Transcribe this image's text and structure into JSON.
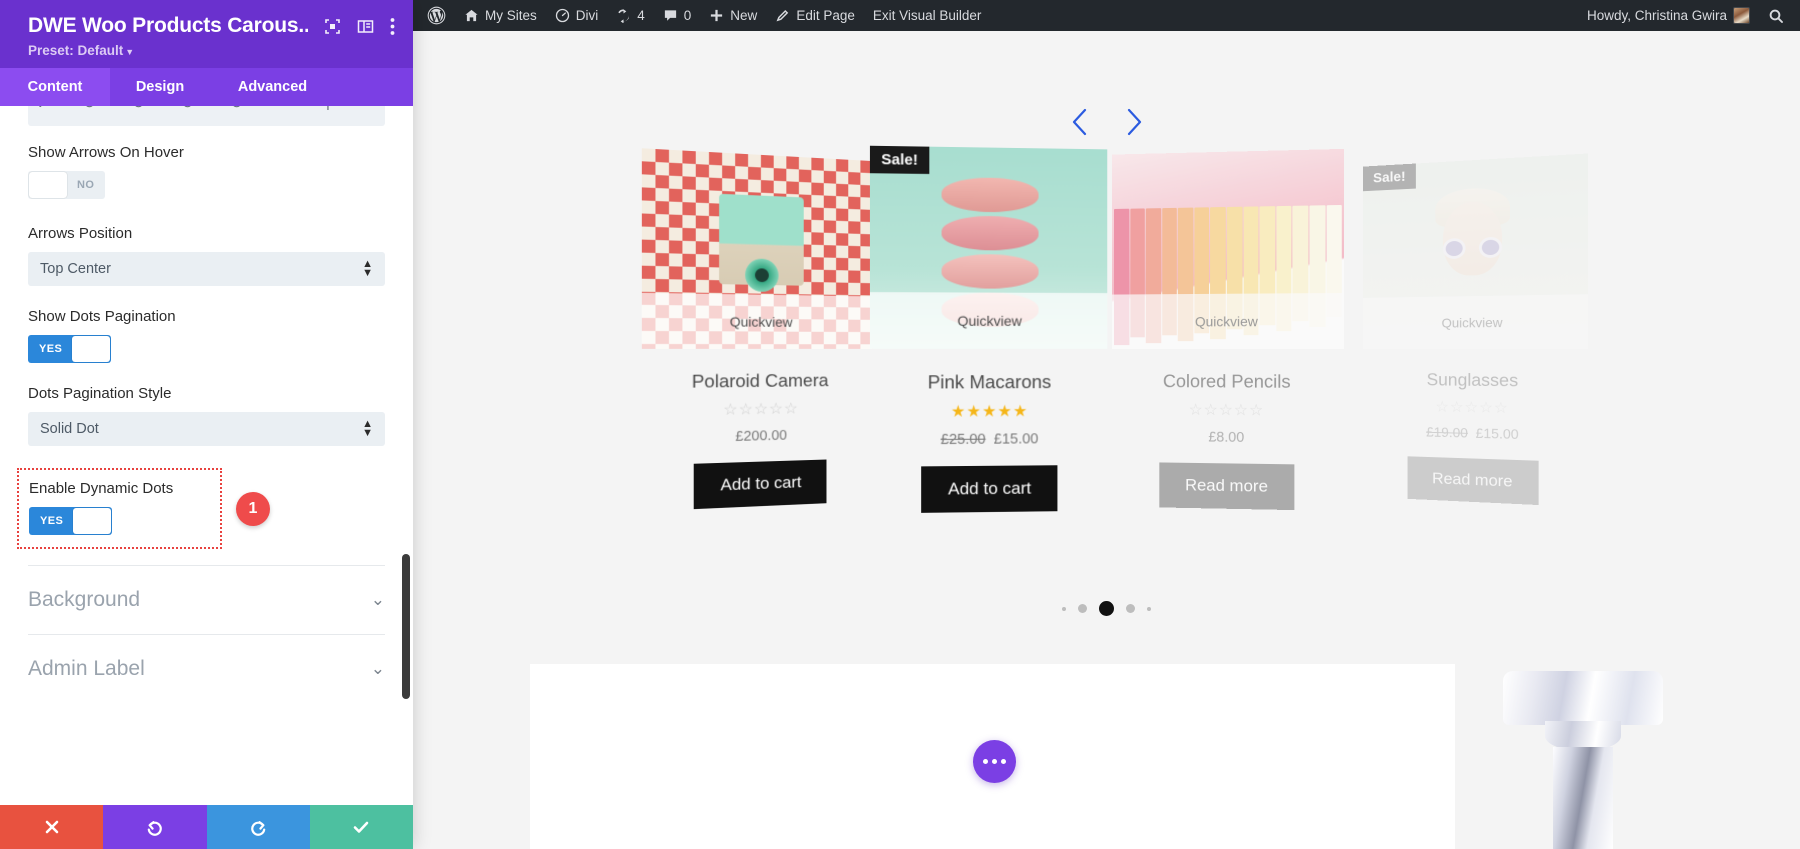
{
  "panel": {
    "title": "DWE Woo Products Carous...",
    "preset": "Preset: Default",
    "icons": {
      "fullscreen": "fullscreen-icon",
      "layout": "split-view-icon",
      "more": "more-vertical-icon"
    },
    "tabs": [
      {
        "label": "Content",
        "active": true
      },
      {
        "label": "Design",
        "active": false
      },
      {
        "label": "Advanced",
        "active": false
      }
    ],
    "fields": [
      {
        "label": "Show Arrows On Hover",
        "type": "toggle",
        "value": "NO",
        "on": false
      },
      {
        "label": "Arrows Position",
        "type": "select",
        "value": "Top Center"
      },
      {
        "label": "Show Dots Pagination",
        "type": "toggle",
        "value": "YES",
        "on": true
      },
      {
        "label": "Dots Pagination Style",
        "type": "select",
        "value": "Solid Dot"
      }
    ],
    "highlighted_field": {
      "label": "Enable Dynamic Dots",
      "value": "YES",
      "on": true,
      "badge": "1",
      "badge_color": "#ef4b4b",
      "outline_color": "#e8423f"
    },
    "accordions": [
      {
        "label": "Background"
      },
      {
        "label": "Admin Label"
      }
    ],
    "actions": [
      {
        "name": "cancel",
        "glyph": "✖",
        "color": "#e8523f"
      },
      {
        "name": "undo",
        "glyph": "↺",
        "color": "#7B3FE4"
      },
      {
        "name": "redo",
        "glyph": "↻",
        "color": "#3B95DE"
      },
      {
        "name": "save",
        "glyph": "✔",
        "color": "#4DC0A0"
      }
    ]
  },
  "adminbar": {
    "wp_logo": "wordpress-logo-icon",
    "items": [
      {
        "label": "My Sites",
        "icon": "home-icon"
      },
      {
        "label": "Divi",
        "icon": "gauge-icon"
      },
      {
        "label": "4",
        "icon": "updates-icon"
      },
      {
        "label": "0",
        "icon": "comment-icon"
      },
      {
        "label": "New",
        "icon": "plus-icon"
      },
      {
        "label": "Edit Page",
        "icon": "pencil-icon"
      },
      {
        "label": "Exit Visual Builder",
        "icon": ""
      }
    ],
    "howdy": "Howdy, Christina Gwira",
    "search_icon": "search-icon"
  },
  "carousel": {
    "prev_icon": "chevron-left-icon",
    "next_icon": "chevron-right-icon",
    "arrow_color": "#2B5BE0",
    "quickview_label": "Quickview",
    "sale_label": "Sale!",
    "products": [
      {
        "title": "Polaroid Camera",
        "rating": 0,
        "price": "£200.00",
        "old_price": "",
        "sale": false,
        "button": "Add to cart",
        "button_style": "dark",
        "image": "polaroid-camera-on-red-checker"
      },
      {
        "title": "Pink Macarons",
        "rating": 5,
        "price": "£15.00",
        "old_price": "£25.00",
        "sale": true,
        "button": "Add to cart",
        "button_style": "dark",
        "image": "stacked-pink-macarons-on-mint"
      },
      {
        "title": "Colored Pencils",
        "rating": 0,
        "price": "£8.00",
        "old_price": "",
        "sale": false,
        "button": "Read more",
        "button_style": "grey",
        "image": "colored-pencils-on-pink"
      },
      {
        "title": "Sunglasses",
        "rating": 0,
        "price": "£15.00",
        "old_price": "£19.00",
        "sale": true,
        "button": "Read more",
        "button_style": "grey",
        "image": "woman-wearing-white-sunglasses"
      }
    ],
    "dots": [
      {
        "size": "xs",
        "active": false
      },
      {
        "size": "sm",
        "active": false
      },
      {
        "size": "lg",
        "active": true
      },
      {
        "size": "sm",
        "active": false
      },
      {
        "size": "xs",
        "active": false
      }
    ]
  },
  "lower": {
    "fab_icon": "more-horizontal-icon",
    "fab_color": "#7B3FE4",
    "decorative_image": "crystal-glass-object"
  }
}
